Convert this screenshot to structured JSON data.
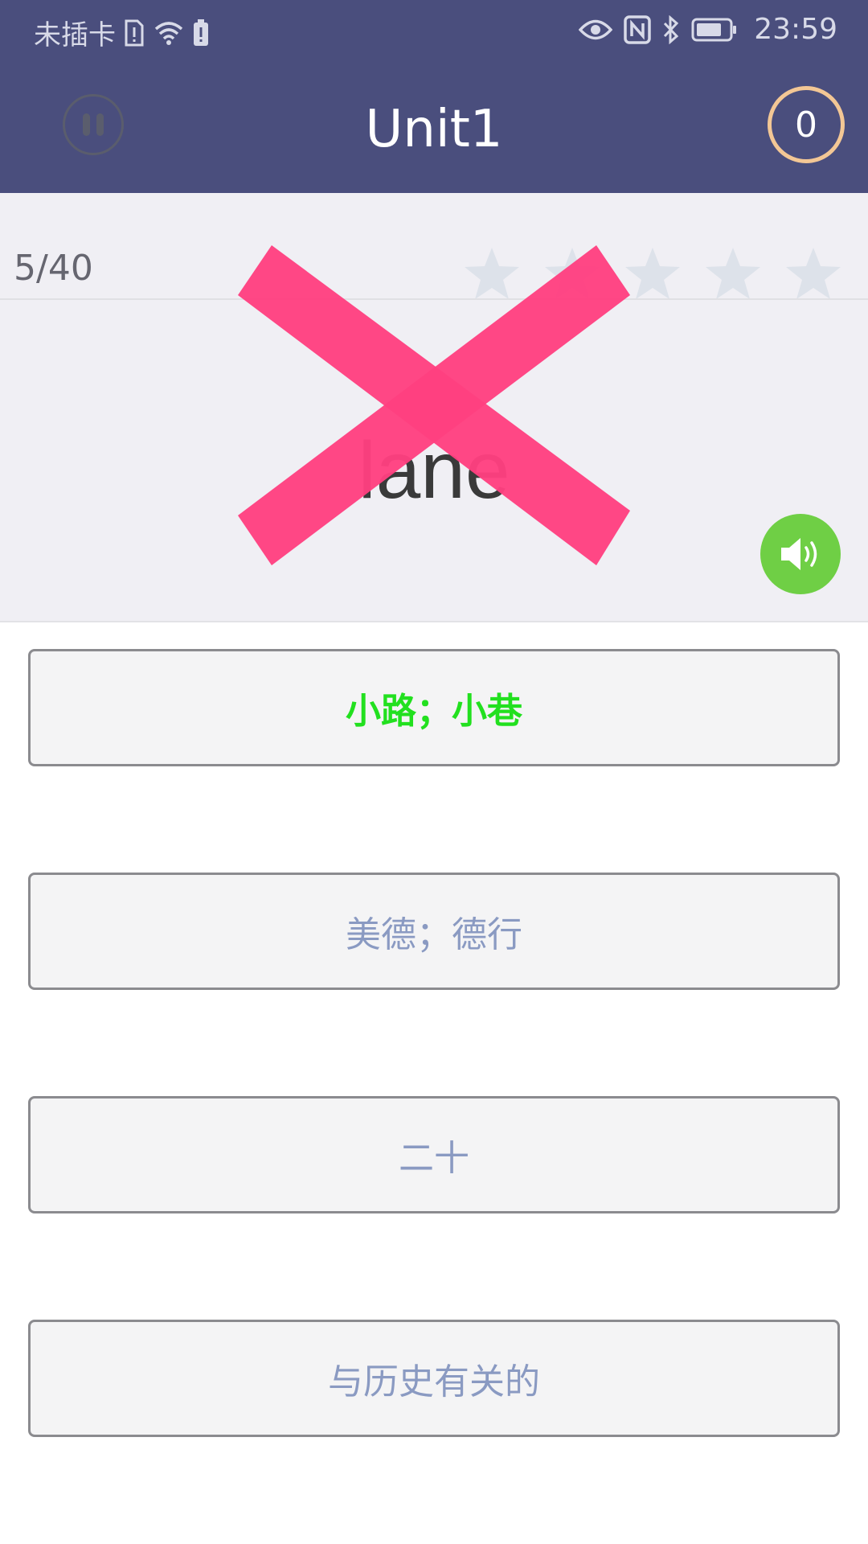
{
  "status_bar": {
    "carrier": "未插卡",
    "time": "23:59"
  },
  "header": {
    "title": "Unit1",
    "score": "0"
  },
  "quiz": {
    "progress": "5/40",
    "stars_total": 5,
    "stars_filled": 0,
    "word": "lane",
    "result": "wrong"
  },
  "options": [
    {
      "label": "小路；小巷",
      "state": "correct"
    },
    {
      "label": "美德；德行",
      "state": "normal"
    },
    {
      "label": "二十",
      "state": "normal"
    },
    {
      "label": "与历史有关的",
      "state": "normal"
    }
  ],
  "colors": {
    "header_bg": "#4a4e7d",
    "score_ring": "#f3c795",
    "wrong_mark": "#ff4080",
    "speaker_bg": "#6fcf45",
    "correct_text": "#22e01f",
    "option_text": "#8a9ac2"
  },
  "icons": {
    "pause": "pause-icon",
    "speaker": "speaker-icon",
    "star": "star-icon",
    "wrong": "cross-icon"
  }
}
